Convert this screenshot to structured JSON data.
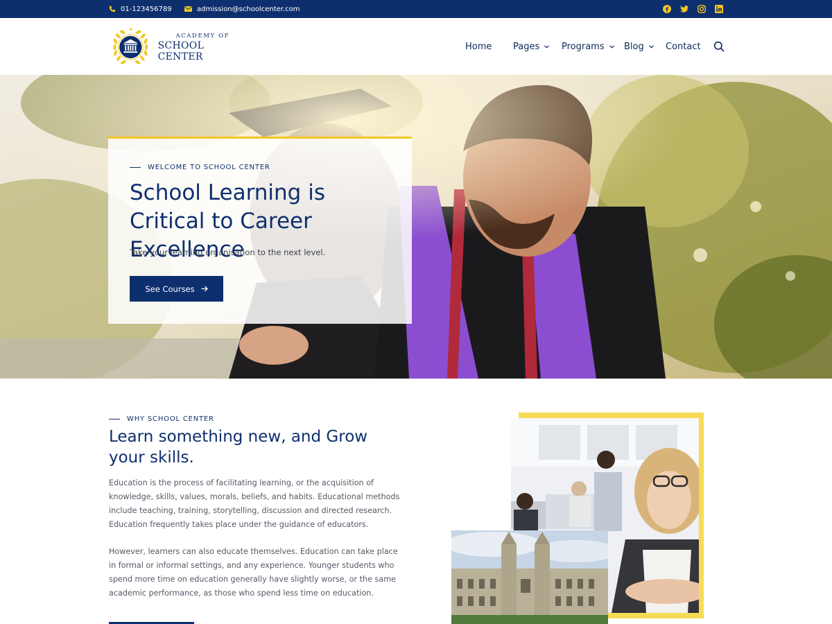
{
  "colors": {
    "primary": "#0e2f6e",
    "accent": "#f3c623",
    "text_muted": "#555a66"
  },
  "topbar": {
    "phone": "01-123456789",
    "phone_icon": "phone-icon",
    "email": "admission@schoolcenter.com",
    "email_icon": "envelope-icon",
    "socials": [
      "facebook-icon",
      "twitter-icon",
      "instagram-icon",
      "linkedin-icon"
    ]
  },
  "header": {
    "logo": {
      "line1": "ACADEMY OF",
      "line2": "SCHOOL CENTER"
    },
    "nav": [
      {
        "label": "Home",
        "has_dropdown": false
      },
      {
        "label": "Pages",
        "has_dropdown": true
      },
      {
        "label": "Programs",
        "has_dropdown": true
      },
      {
        "label": "Blog",
        "has_dropdown": true
      },
      {
        "label": "Contact",
        "has_dropdown": false
      }
    ],
    "search_icon": "search-icon"
  },
  "hero": {
    "eyebrow": "WELCOME TO SCHOOL CENTER",
    "title": "School Learning is Critical to Career Excellence",
    "subtitle": "Take your learning organisation to the next level.",
    "button": "See Courses",
    "button_icon": "arrow-right-icon"
  },
  "why": {
    "eyebrow": "WHY SCHOOL CENTER",
    "title": "Learn something new, and Grow your skills.",
    "paragraph1": "Education is the process of facilitating learning, or the acquisition of knowledge, skills, values, morals, beliefs, and habits. Educational methods include teaching, training, storytelling, discussion and directed research. Education frequently takes place under the guidance of educators.",
    "paragraph2": "However, learners can also educate themselves. Education can take place in formal or informal settings, and any experience. Younger students who spend more time on education generally have slightly worse, or the same academic performance, as those who spend less time on education."
  }
}
